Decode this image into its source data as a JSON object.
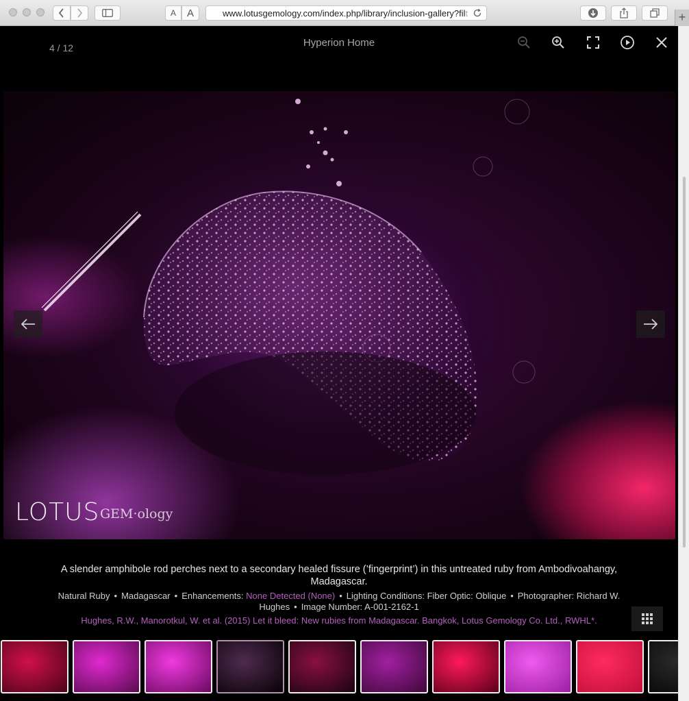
{
  "browser": {
    "url_main": "www.lotusgemology.com/index.php/library/inclusion-gallery?fil",
    "url_fade": "t",
    "reader_small": "A",
    "reader_large": "A"
  },
  "lightbox": {
    "counter": "4 / 12",
    "title": "Hyperion Home",
    "caption": "A slender amphibole rod perches next to a secondary healed fissure (’fingerprint’) in this untreated ruby from Ambodivoahangy, Madagascar.",
    "meta": {
      "gem": "Natural Ruby",
      "origin": "Madagascar",
      "enh_label": "Enhancements:",
      "enh_value": "None Detected (None)",
      "lighting": "Lighting Conditions: Fiber Optic: Oblique",
      "photographer": "Photographer: Richard W. Hughes",
      "image_number": "Image Number: A-001-2162-1",
      "bullet": "•"
    },
    "reference": "Hughes, R.W., Manorotkul, W. et al. (2015) Let it bleed: New rubies from Madagascar. Bangkok, Lotus Gemology Co. Ltd., RWHL*.",
    "watermark": {
      "main": "LOTUS",
      "sub": "GEM·ology"
    },
    "icons": [
      "zoom-out-icon",
      "zoom-in-icon",
      "fullscreen-icon",
      "play-icon",
      "close-icon",
      "arrow-left-icon",
      "arrow-right-icon",
      "grid-icon"
    ]
  },
  "thumbnails": [
    {
      "c1": "#d0104a",
      "c2": "#4a0418"
    },
    {
      "c1": "#e02ad0",
      "c2": "#5a0a50"
    },
    {
      "c1": "#f03ae0",
      "c2": "#6a0a60"
    },
    {
      "c1": "#6a3a6a",
      "c2": "#0a0208"
    },
    {
      "c1": "#8a1040",
      "c2": "#1a0410"
    },
    {
      "c1": "#a020a0",
      "c2": "#40083a"
    },
    {
      "c1": "#ff1a5a",
      "c2": "#5a0018"
    },
    {
      "c1": "#f05af0",
      "c2": "#9a20a0"
    },
    {
      "c1": "#ff2a60",
      "c2": "#c0103a"
    },
    {
      "c1": "#2a2a2a",
      "c2": "#050505"
    }
  ]
}
